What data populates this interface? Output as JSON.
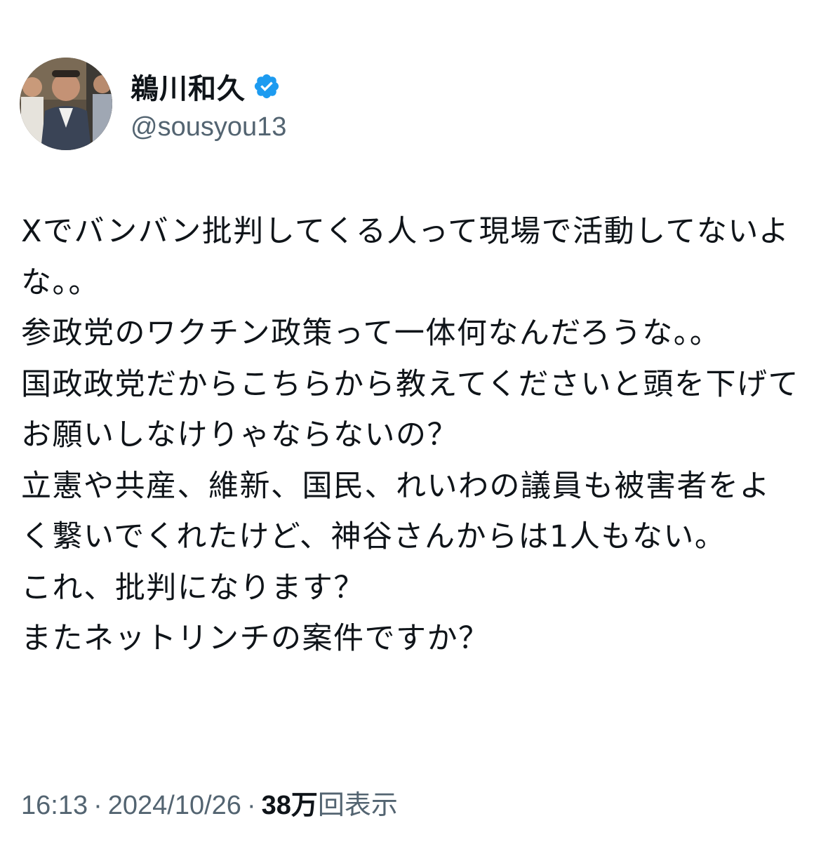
{
  "author": {
    "display_name": "鵜川和久",
    "handle": "@sousyou13",
    "verified": true,
    "avatar_icon": "user-avatar"
  },
  "tweet": {
    "text": "Xでバンバン批判してくる人って現場で活動してないよな。。\n参政党のワクチン政策って一体何なんだろうな。。\n国政政党だからこちらから教えてくださいと頭を下げてお願いしなけりゃならないの？\n立憲や共産、維新、国民、れいわの議員も被害者をよく繋いでくれたけど、神谷さんからは1人もない。\nこれ、批判になります？\nまたネットリンチの案件ですか？"
  },
  "meta": {
    "time": "16:13",
    "separator": "·",
    "date": "2024/10/26",
    "views_count": "38万",
    "views_label": "回表示"
  },
  "colors": {
    "text": "#0f1419",
    "secondary": "#536471",
    "verified": "#1d9bf0"
  }
}
